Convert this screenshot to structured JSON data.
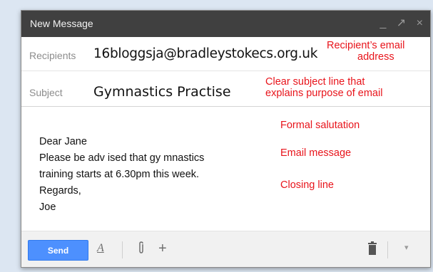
{
  "window": {
    "title": "New Message",
    "controls": {
      "minimize": "_",
      "popout": "↗",
      "close": "×"
    }
  },
  "recipients": {
    "label": "Recipients",
    "value": "16bloggsja@bradleystokecs.org.uk"
  },
  "subject": {
    "label": "Subject",
    "value": "Gymnastics Practise"
  },
  "body": {
    "lines": [
      "Dear Jane",
      "Please be adv ised that gy mnastics",
      "training  starts at 6.30pm this week.",
      "Regards,",
      "Joe"
    ]
  },
  "annotations": {
    "recipient_1": "Recipient’s email",
    "recipient_2": "address",
    "subject_1": "Clear subject line that",
    "subject_2": "explains purpose of email",
    "salutation": "Formal salutation",
    "message": "Email message",
    "closing": "Closing line"
  },
  "toolbar": {
    "send_label": "Send",
    "format_glyph": "A",
    "add_glyph": "+",
    "more_glyph": "▾"
  },
  "colors": {
    "annotation": "#e8141b",
    "send_button": "#4d90fe",
    "titlebar": "#404040",
    "background": "#dce6f2"
  }
}
